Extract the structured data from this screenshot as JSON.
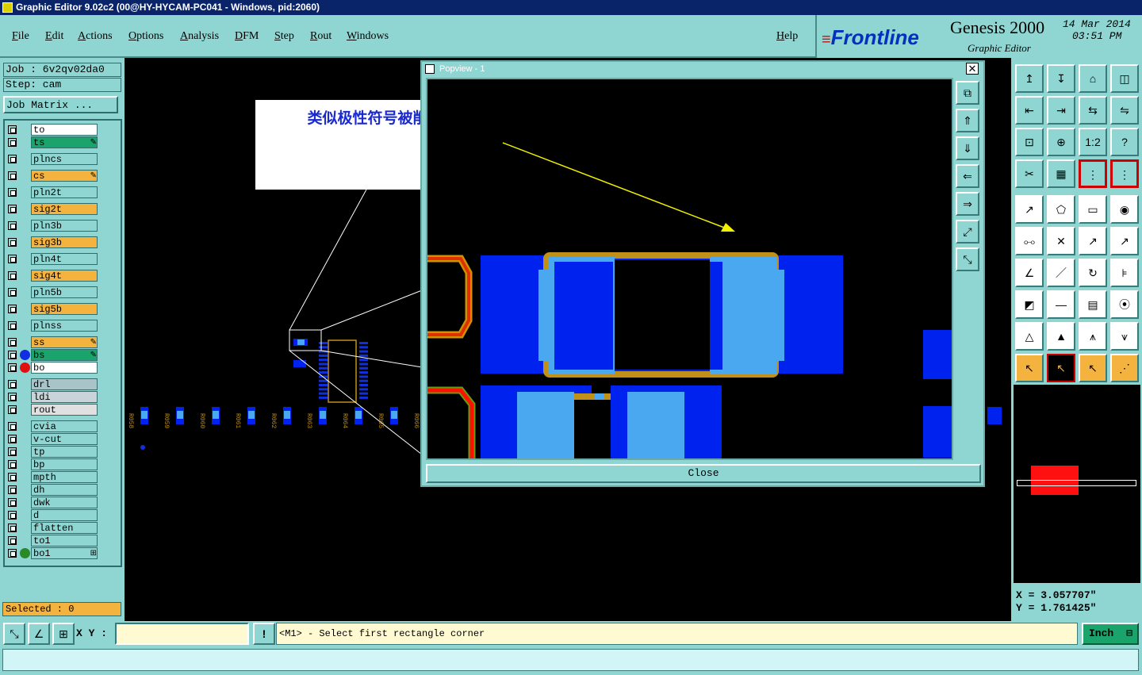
{
  "window": {
    "title": "Graphic Editor 9.02c2 (00@HY-HYCAM-PC041 - Windows, pid:2060)"
  },
  "menu": {
    "items": [
      "File",
      "Edit",
      "Actions",
      "Options",
      "Analysis",
      "DFM",
      "Step",
      "Rout",
      "Windows"
    ],
    "help": "Help"
  },
  "brand": {
    "logo": "Frontline",
    "product": "Genesis 2000",
    "subtitle": "Graphic Editor",
    "date": "14 Mar 2014",
    "time": "03:51 PM"
  },
  "job": {
    "job_label": "Job  :  6v2qv02da0",
    "step_label": "Step:  cam",
    "matrix_button": "Job Matrix ..."
  },
  "layers": [
    {
      "name": "to",
      "color": "#ffffff"
    },
    {
      "name": "ts",
      "color": "#1aa36a",
      "mark": "✎"
    },
    {
      "name": "plncs",
      "color": "#8fd6d2"
    },
    {
      "name": "cs",
      "color": "#f4b23e",
      "mark": "✎"
    },
    {
      "name": "pln2t",
      "color": "#8fd6d2"
    },
    {
      "name": "sig2t",
      "color": "#f4b23e"
    },
    {
      "name": "pln3b",
      "color": "#8fd6d2"
    },
    {
      "name": "sig3b",
      "color": "#f4b23e"
    },
    {
      "name": "pln4t",
      "color": "#8fd6d2"
    },
    {
      "name": "sig4t",
      "color": "#f4b23e"
    },
    {
      "name": "pln5b",
      "color": "#8fd6d2"
    },
    {
      "name": "sig5b",
      "color": "#f4b23e"
    },
    {
      "name": "plnss",
      "color": "#8fd6d2"
    },
    {
      "name": "ss",
      "color": "#f4b23e",
      "mark": "✎"
    },
    {
      "name": "bs",
      "color": "#1aa36a",
      "mark": "✎",
      "dot": "#1030e0"
    },
    {
      "name": "bo",
      "color": "#ffffff",
      "dot": "#e01010"
    },
    {
      "name": "drl",
      "color": "#a8c4c8"
    },
    {
      "name": "ldi",
      "color": "#c8d4d8"
    },
    {
      "name": "rout",
      "color": "#e0e0e0"
    },
    {
      "name": "cvia",
      "color": "#8fd6d2"
    },
    {
      "name": "v-cut",
      "color": "#8fd6d2"
    },
    {
      "name": "tp",
      "color": "#8fd6d2"
    },
    {
      "name": "bp",
      "color": "#8fd6d2"
    },
    {
      "name": "mpth",
      "color": "#8fd6d2"
    },
    {
      "name": "dh",
      "color": "#8fd6d2"
    },
    {
      "name": "dwk",
      "color": "#8fd6d2"
    },
    {
      "name": "d",
      "color": "#8fd6d2"
    },
    {
      "name": "flatten",
      "color": "#8fd6d2"
    },
    {
      "name": "to1",
      "color": "#8fd6d2"
    },
    {
      "name": "bo1",
      "color": "#8fd6d2",
      "dot": "#2a8a2a",
      "mark": "⊞"
    }
  ],
  "selected": "Selected : 0",
  "annotation": {
    "text": "类似极性符号被削"
  },
  "popview": {
    "title": "Popview - 1",
    "close_label": "Close"
  },
  "coords": {
    "x": "X = 3.057707\"",
    "y": "Y = 1.761425\""
  },
  "status": {
    "xy_label": "X Y :",
    "xy_value": "",
    "prompt": "<M1> - Select first rectangle corner",
    "units": "Inch"
  },
  "canvas_labels": [
    "R058",
    "R059",
    "R060",
    "R061",
    "R062",
    "R063",
    "R064",
    "R065",
    "R066",
    "R067"
  ],
  "colors": {
    "panel": "#8fd6d2",
    "pad_dark": "#0022ee",
    "pad_light": "#4aa8f0",
    "silk": "#c09018",
    "arrow": "#f0f000"
  }
}
